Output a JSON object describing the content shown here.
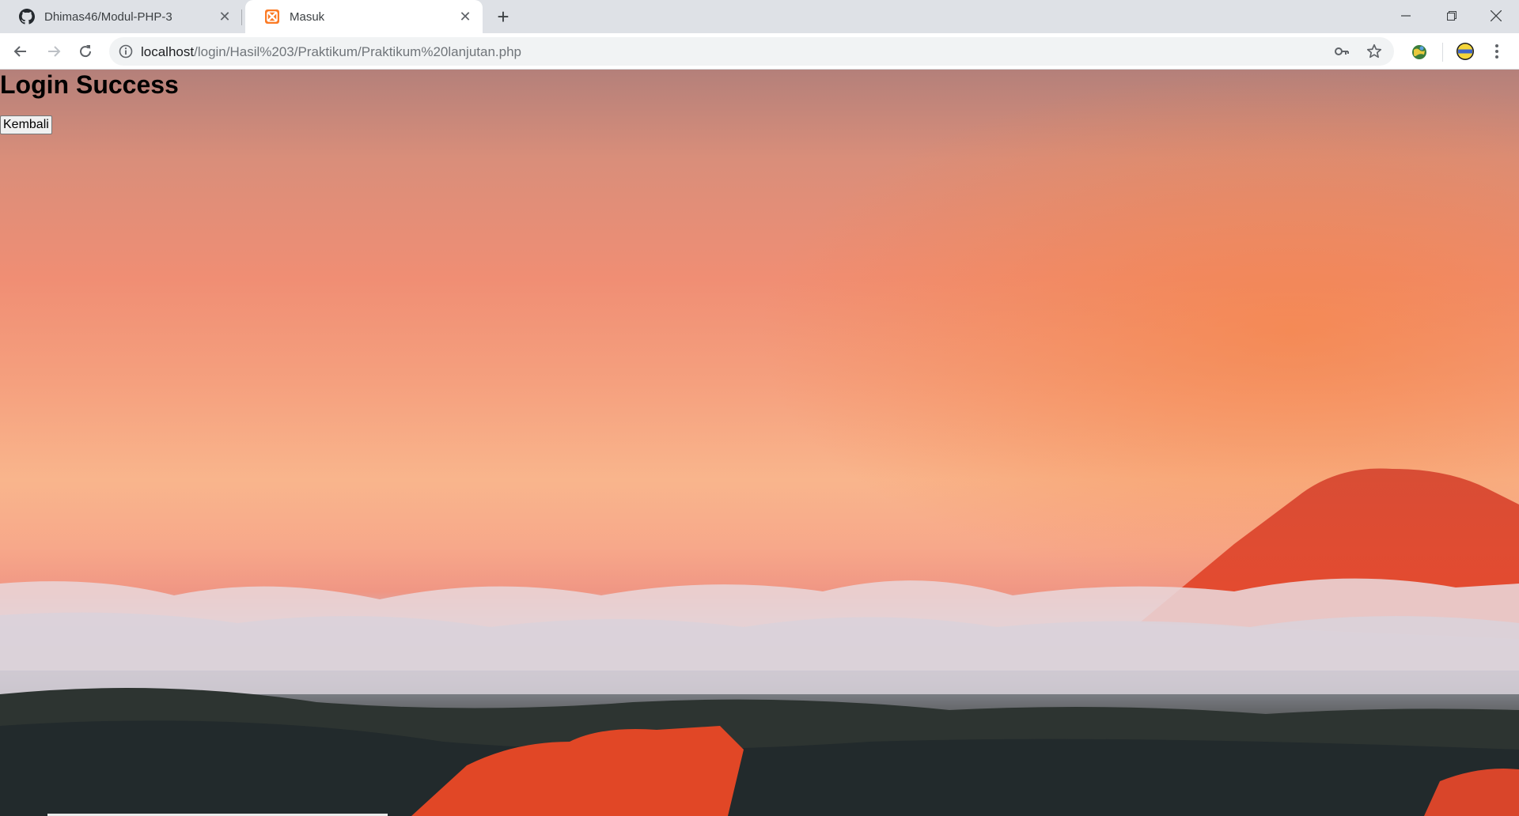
{
  "browser": {
    "tabs": [
      {
        "title": "Dhimas46/Modul-PHP-3",
        "icon": "github-icon",
        "active": false
      },
      {
        "title": "Masuk",
        "icon": "xampp-icon",
        "active": true
      }
    ],
    "address": {
      "host": "localhost",
      "path": "/login/Hasil%203/Praktikum/Praktikum%20lanjutan.php"
    }
  },
  "page": {
    "heading": "Login Success",
    "back_button_label": "Kembali"
  },
  "colors": {
    "tab_strip": "#dee1e6",
    "omnibox": "#f1f3f4",
    "xampp_orange": "#fb7a24"
  }
}
